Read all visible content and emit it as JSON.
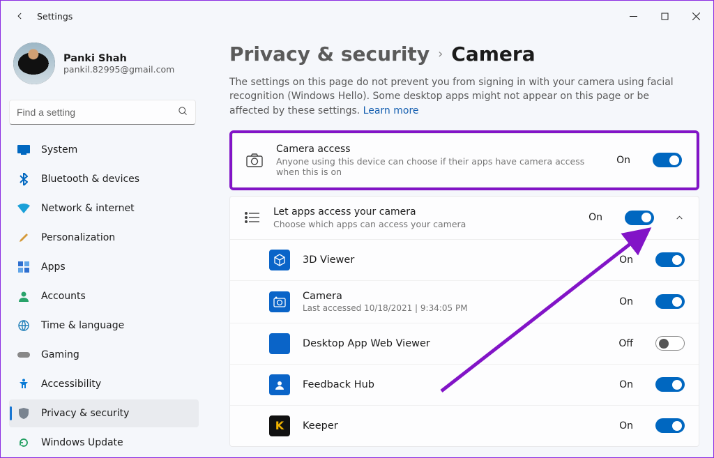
{
  "window": {
    "title": "Settings"
  },
  "profile": {
    "name": "Panki Shah",
    "email": "pankil.82995@gmail.com"
  },
  "search": {
    "placeholder": "Find a setting"
  },
  "sidebar": {
    "items": [
      {
        "label": "System"
      },
      {
        "label": "Bluetooth & devices"
      },
      {
        "label": "Network & internet"
      },
      {
        "label": "Personalization"
      },
      {
        "label": "Apps"
      },
      {
        "label": "Accounts"
      },
      {
        "label": "Time & language"
      },
      {
        "label": "Gaming"
      },
      {
        "label": "Accessibility"
      },
      {
        "label": "Privacy & security"
      },
      {
        "label": "Windows Update"
      }
    ]
  },
  "breadcrumb": {
    "parent": "Privacy & security",
    "current": "Camera"
  },
  "description": {
    "text": "The settings on this page do not prevent you from signing in with your camera using facial recognition (Windows Hello). Some desktop apps might not appear on this page or be affected by these settings.",
    "learn_more": "Learn more"
  },
  "camera_access": {
    "title": "Camera access",
    "subtitle": "Anyone using this device can choose if their apps have camera access when this is on",
    "state_label": "On",
    "state": true
  },
  "apps_access": {
    "title": "Let apps access your camera",
    "subtitle": "Choose which apps can access your camera",
    "state_label": "On",
    "state": true,
    "expanded": true,
    "apps": [
      {
        "name": "3D Viewer",
        "state_label": "On",
        "state": true,
        "icon": "3d"
      },
      {
        "name": "Camera",
        "sub": "Last accessed 10/18/2021 | 9:34:05 PM",
        "state_label": "On",
        "state": true,
        "icon": "cam"
      },
      {
        "name": "Desktop App Web Viewer",
        "state_label": "Off",
        "state": false,
        "icon": "desk"
      },
      {
        "name": "Feedback Hub",
        "state_label": "On",
        "state": true,
        "icon": "fb"
      },
      {
        "name": "Keeper",
        "state_label": "On",
        "state": true,
        "icon": "keeper"
      }
    ]
  }
}
